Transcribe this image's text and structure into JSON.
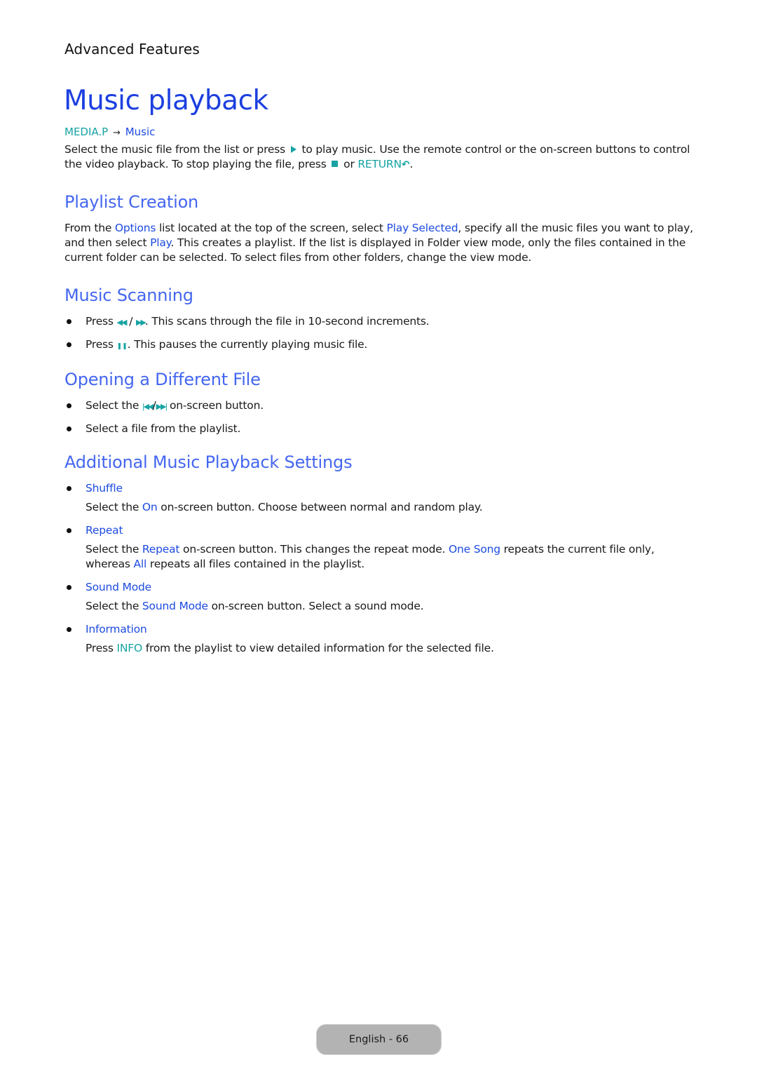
{
  "header": {
    "chapter": "Advanced Features"
  },
  "title": "Music playback",
  "path": {
    "source": "MEDIA.P",
    "arrow": "→",
    "target": "Music"
  },
  "intro": {
    "t1": "Select the music file from the list or press",
    "t2": "to play music. Use the remote control or the on-screen buttons to control the video playback. To stop playing the file, press",
    "t3": "or",
    "return_label": "RETURN",
    "return_glyph": "↶",
    "t4": "."
  },
  "sections": {
    "playlist": {
      "heading": "Playlist Creation",
      "t1": "From the",
      "k1": "Options",
      "t2": "list located at the top of the screen, select",
      "k2": "Play Selected",
      "t3": ", specify all the music files you want to play, and then select",
      "k3": "Play",
      "t4": ". This creates a playlist. If the list is displayed in Folder view mode, only the files contained in the current folder can be selected. To select files from other folders, change the view mode."
    },
    "scanning": {
      "heading": "Music Scanning",
      "items": [
        {
          "pre": "Press",
          "icon_a": "◀◀",
          "sep": "/",
          "icon_b": "▶▶",
          "post": ". This scans through the file in 10-second increments."
        },
        {
          "pre": "Press",
          "icon_a": "❚❚",
          "post": ". This pauses the currently playing music file."
        }
      ]
    },
    "different_file": {
      "heading": "Opening a Different File",
      "items": [
        {
          "pre": "Select the",
          "icon_a": "|◀◀",
          "sep": "/",
          "icon_b": "▶▶|",
          "post": "on-screen button."
        },
        {
          "text": "Select a file from the playlist."
        }
      ]
    },
    "additional": {
      "heading": "Additional Music Playback Settings",
      "items": [
        {
          "label": "Shuffle",
          "d1": "Select the",
          "k1": "On",
          "d2": "on-screen button. Choose between normal and random play."
        },
        {
          "label": "Repeat",
          "d1": "Select the",
          "k1": "Repeat",
          "d2": "on-screen button. This changes the repeat mode.",
          "k2": "One Song",
          "d3": "repeats the current file only, whereas",
          "k3": "All",
          "d4": "repeats all files contained in the playlist."
        },
        {
          "label": "Sound Mode",
          "d1": "Select the",
          "k1": "Sound Mode",
          "d2": "on-screen button. Select a sound mode."
        },
        {
          "label": "Information",
          "d1": "Press",
          "k1": "INFO",
          "d2": "from the playlist to view detailed information for the selected file."
        }
      ]
    }
  },
  "footer": {
    "page_label": "English - 66"
  },
  "colors": {
    "title": "#1c3fe0",
    "heading": "#4466f0",
    "keyword_blue": "#1d4be0",
    "keyword_teal": "#17a3a3",
    "footer_bg": "#b3b3b3"
  }
}
